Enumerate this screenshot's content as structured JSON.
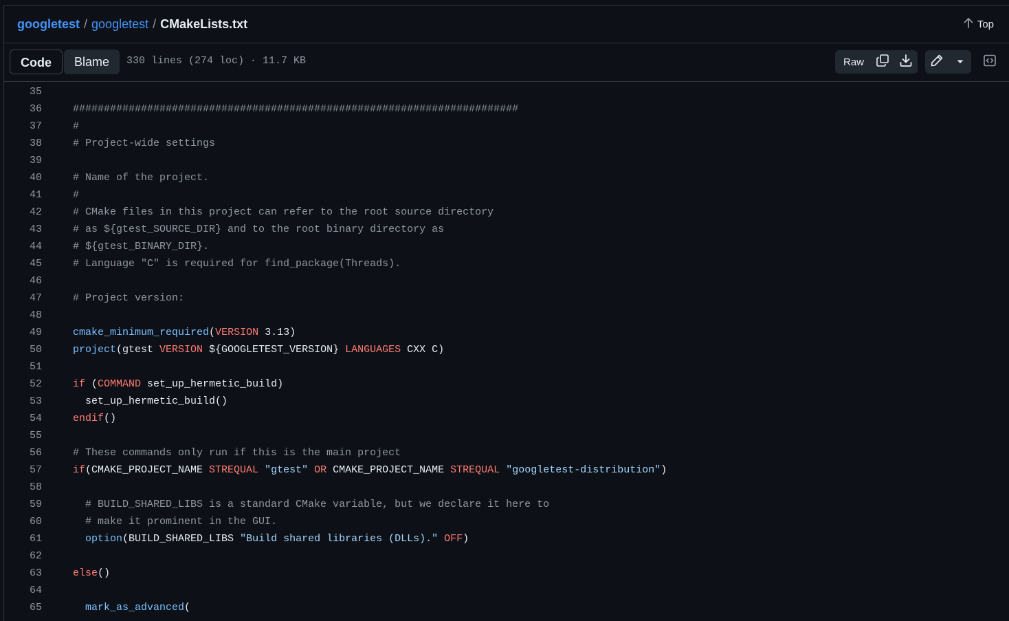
{
  "breadcrumb": {
    "owner": "googletest",
    "repo": "googletest",
    "separator": "/",
    "file": "CMakeLists.txt"
  },
  "top_button": {
    "label": "Top",
    "icon": "arrow-up-icon"
  },
  "tabs": [
    {
      "label": "Code",
      "active": true
    },
    {
      "label": "Blame",
      "active": false
    }
  ],
  "file_info": "330 lines (274 loc) · 11.7 KB",
  "actions": {
    "raw_label": "Raw",
    "icons": [
      "copy-icon",
      "download-icon",
      "pencil-icon",
      "triangle-down-icon",
      "code-square-icon"
    ]
  },
  "colors": {
    "background": "#0d1117",
    "link": "#4493f8",
    "comment": "#9198a1",
    "function": "#79c0ff",
    "keyword": "#ff7b72",
    "string": "#a5d6ff"
  },
  "code_lines": [
    {
      "n": "35",
      "tokens": []
    },
    {
      "n": "36",
      "tokens": [
        {
          "t": "c",
          "v": "########################################################################"
        }
      ]
    },
    {
      "n": "37",
      "tokens": [
        {
          "t": "c",
          "v": "#"
        }
      ]
    },
    {
      "n": "38",
      "tokens": [
        {
          "t": "c",
          "v": "# Project-wide settings"
        }
      ]
    },
    {
      "n": "39",
      "tokens": []
    },
    {
      "n": "40",
      "tokens": [
        {
          "t": "c",
          "v": "# Name of the project."
        }
      ]
    },
    {
      "n": "41",
      "tokens": [
        {
          "t": "c",
          "v": "#"
        }
      ]
    },
    {
      "n": "42",
      "tokens": [
        {
          "t": "c",
          "v": "# CMake files in this project can refer to the root source directory"
        }
      ]
    },
    {
      "n": "43",
      "tokens": [
        {
          "t": "c",
          "v": "# as ${gtest_SOURCE_DIR} and to the root binary directory as"
        }
      ]
    },
    {
      "n": "44",
      "tokens": [
        {
          "t": "c",
          "v": "# ${gtest_BINARY_DIR}."
        }
      ]
    },
    {
      "n": "45",
      "tokens": [
        {
          "t": "c",
          "v": "# Language \"C\" is required for find_package(Threads)."
        }
      ]
    },
    {
      "n": "46",
      "tokens": []
    },
    {
      "n": "47",
      "tokens": [
        {
          "t": "c",
          "v": "# Project version:"
        }
      ]
    },
    {
      "n": "48",
      "tokens": []
    },
    {
      "n": "49",
      "tokens": [
        {
          "t": "fn",
          "v": "cmake_minimum_required"
        },
        {
          "t": "p",
          "v": "("
        },
        {
          "t": "kw",
          "v": "VERSION"
        },
        {
          "t": "p",
          "v": " 3.13)"
        }
      ]
    },
    {
      "n": "50",
      "tokens": [
        {
          "t": "fn",
          "v": "project"
        },
        {
          "t": "p",
          "v": "(gtest "
        },
        {
          "t": "kw",
          "v": "VERSION"
        },
        {
          "t": "p",
          "v": " ${GOOGLETEST_VERSION} "
        },
        {
          "t": "kw",
          "v": "LANGUAGES"
        },
        {
          "t": "p",
          "v": " CXX C)"
        }
      ]
    },
    {
      "n": "51",
      "tokens": []
    },
    {
      "n": "52",
      "tokens": [
        {
          "t": "kw",
          "v": "if"
        },
        {
          "t": "p",
          "v": " ("
        },
        {
          "t": "kw",
          "v": "COMMAND"
        },
        {
          "t": "p",
          "v": " set_up_hermetic_build)"
        }
      ]
    },
    {
      "n": "53",
      "tokens": [
        {
          "t": "p",
          "v": "  set_up_hermetic_build()"
        }
      ]
    },
    {
      "n": "54",
      "tokens": [
        {
          "t": "kw",
          "v": "endif"
        },
        {
          "t": "p",
          "v": "()"
        }
      ]
    },
    {
      "n": "55",
      "tokens": []
    },
    {
      "n": "56",
      "tokens": [
        {
          "t": "c",
          "v": "# These commands only run if this is the main project"
        }
      ]
    },
    {
      "n": "57",
      "tokens": [
        {
          "t": "kw",
          "v": "if"
        },
        {
          "t": "p",
          "v": "(CMAKE_PROJECT_NAME "
        },
        {
          "t": "kw",
          "v": "STREQUAL"
        },
        {
          "t": "p",
          "v": " "
        },
        {
          "t": "str",
          "v": "\"gtest\""
        },
        {
          "t": "p",
          "v": " "
        },
        {
          "t": "kw",
          "v": "OR"
        },
        {
          "t": "p",
          "v": " CMAKE_PROJECT_NAME "
        },
        {
          "t": "kw",
          "v": "STREQUAL"
        },
        {
          "t": "p",
          "v": " "
        },
        {
          "t": "str",
          "v": "\"googletest-distribution\""
        },
        {
          "t": "p",
          "v": ")"
        }
      ]
    },
    {
      "n": "58",
      "tokens": []
    },
    {
      "n": "59",
      "tokens": [
        {
          "t": "c",
          "v": "  # BUILD_SHARED_LIBS is a standard CMake variable, but we declare it here to"
        }
      ]
    },
    {
      "n": "60",
      "tokens": [
        {
          "t": "c",
          "v": "  # make it prominent in the GUI."
        }
      ]
    },
    {
      "n": "61",
      "tokens": [
        {
          "t": "p",
          "v": "  "
        },
        {
          "t": "fn",
          "v": "option"
        },
        {
          "t": "p",
          "v": "(BUILD_SHARED_LIBS "
        },
        {
          "t": "str",
          "v": "\"Build shared libraries (DLLs).\""
        },
        {
          "t": "p",
          "v": " "
        },
        {
          "t": "kw",
          "v": "OFF"
        },
        {
          "t": "p",
          "v": ")"
        }
      ]
    },
    {
      "n": "62",
      "tokens": []
    },
    {
      "n": "63",
      "tokens": [
        {
          "t": "kw",
          "v": "else"
        },
        {
          "t": "p",
          "v": "()"
        }
      ]
    },
    {
      "n": "64",
      "tokens": []
    },
    {
      "n": "65",
      "tokens": [
        {
          "t": "p",
          "v": "  "
        },
        {
          "t": "fn",
          "v": "mark_as_advanced"
        },
        {
          "t": "p",
          "v": "("
        }
      ]
    }
  ]
}
